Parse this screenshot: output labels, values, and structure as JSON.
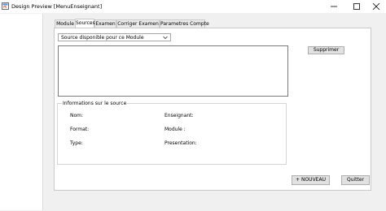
{
  "window": {
    "title": "Design Preview [MenuEnseignant]",
    "icon": "java-app-icon",
    "controls": [
      "minimize-icon",
      "maximize-icon",
      "close-icon"
    ]
  },
  "tabs": [
    {
      "label": "Module",
      "active": false
    },
    {
      "label": "Sources",
      "active": true
    },
    {
      "label": "Examen",
      "active": false
    },
    {
      "label": "Corriger Examen",
      "active": false
    },
    {
      "label": "Parametres Compte",
      "active": false
    }
  ],
  "sources": {
    "select_value": "Source disponible pour ce Module",
    "delete_label": "Supprimer",
    "info": {
      "title": "Informations sur le source",
      "nom_label": "Nom:",
      "format_label": "Format:",
      "type_label": "Type:",
      "enseignant_label": "Enseignant:",
      "module_label": "Module :",
      "presentation_label": "Presentation:"
    },
    "new_label": "+ NOUVEAU",
    "quit_label": "Quitter"
  }
}
